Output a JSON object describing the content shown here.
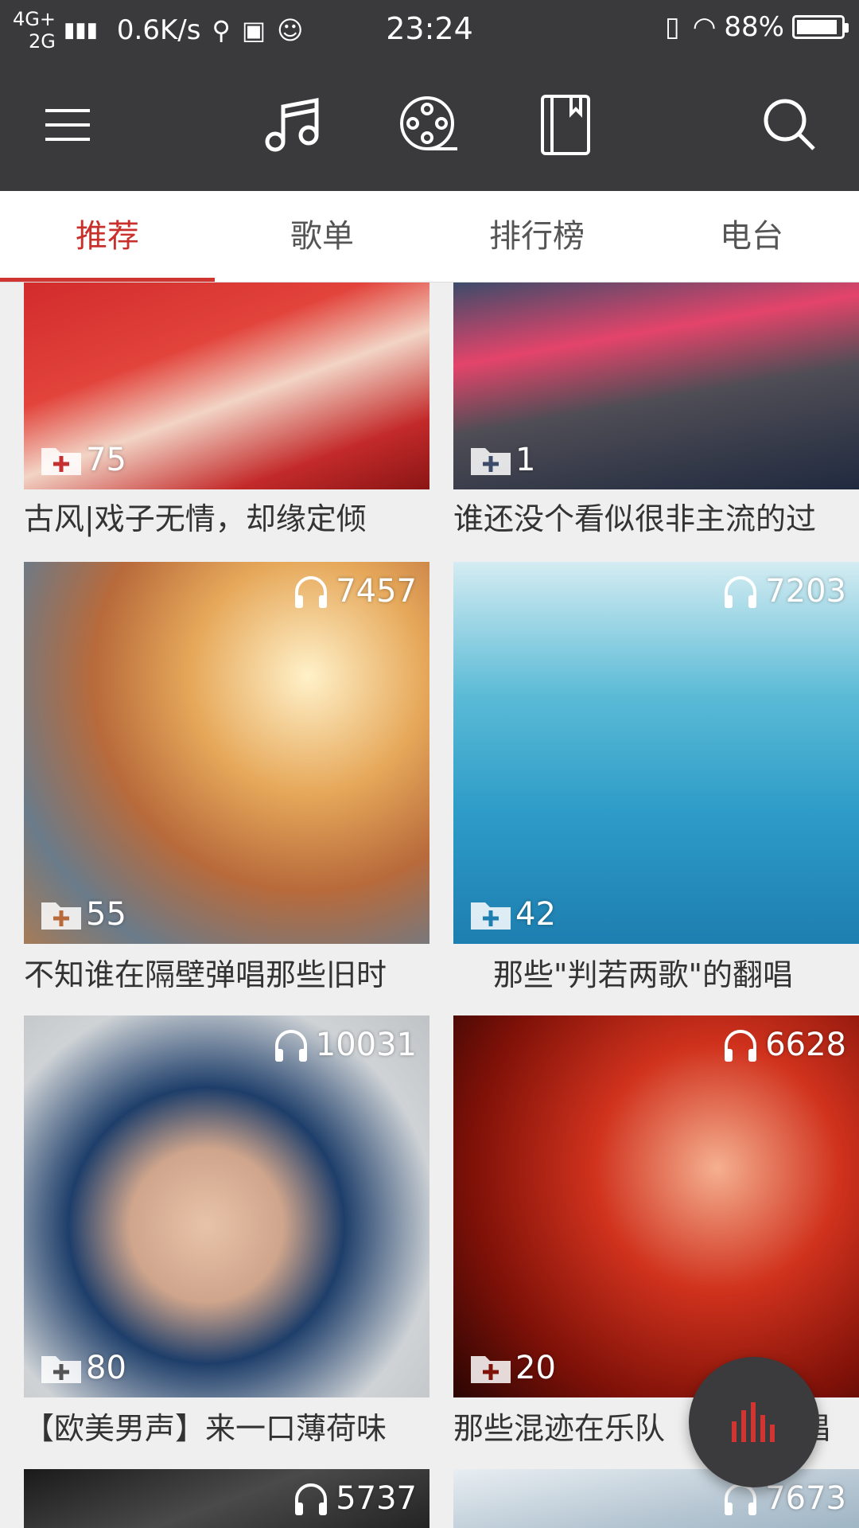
{
  "status_bar": {
    "net_top": "4G+",
    "net_bottom": "2G",
    "speed": "0.6K/s",
    "time": "23:24",
    "battery": "88%",
    "battery_level": 0.88
  },
  "tabs": [
    {
      "label": "推荐",
      "active": true
    },
    {
      "label": "歌单",
      "active": false
    },
    {
      "label": "排行榜",
      "active": false
    },
    {
      "label": "电台",
      "active": false
    }
  ],
  "cards": [
    {
      "title": "古风|戏子无情，却缘定倾",
      "favorites": "75",
      "plays": ""
    },
    {
      "title": "谁还没个看似很非主流的过",
      "favorites": "1",
      "plays": ""
    },
    {
      "title": "不知谁在隔壁弹唱那些旧时",
      "favorites": "55",
      "plays": "7457"
    },
    {
      "title": "那些\"判若两歌\"的翻唱",
      "favorites": "42",
      "plays": "7203"
    },
    {
      "title": "【欧美男声】来一口薄荷味",
      "favorites": "80",
      "plays": "10031"
    },
    {
      "title": "那些混迹在乐队",
      "title_end": "唱",
      "favorites": "20",
      "plays": "6628"
    },
    {
      "title": "",
      "favorites": "",
      "plays": "5737"
    },
    {
      "title": "",
      "favorites": "",
      "plays": "7673"
    }
  ],
  "colors": {
    "accent": "#d03531",
    "bar": "#3a3a3c"
  }
}
